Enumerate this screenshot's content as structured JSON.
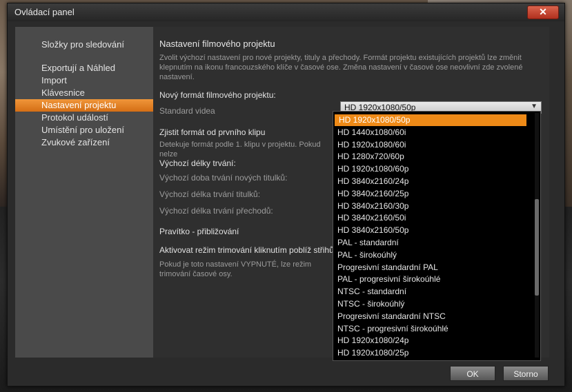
{
  "window": {
    "title": "Ovládací panel",
    "close_glyph": "✕"
  },
  "sidebar": {
    "items": [
      {
        "label": "Složky pro sledování"
      },
      {
        "label": "Exportují a Náhled"
      },
      {
        "label": "Import"
      },
      {
        "label": "Klávesnice"
      },
      {
        "label": "Nastavení projektu"
      },
      {
        "label": "Protokol událostí"
      },
      {
        "label": "Umístění pro uložení"
      },
      {
        "label": "Zvukové zařízení"
      }
    ],
    "active_index": 4
  },
  "content": {
    "heading": "Nastavení filmového projektu",
    "description": "Zvolit výchozí nastavení pro nové projekty, tituly a přechody. Formát projektu existujících projektů lze změnit klepnutím na ikonu francouzského klíče v časové ose. Změna nastavení v časové ose neovlivní zde zvolené nastavení.",
    "new_format_label": "Nový formát filmového projektu:",
    "standard_label": "Standard videa",
    "select_value": "HD 1920x1080/50p",
    "detect_label": "Zjistit formát od prvního klipu",
    "detect_desc": "Detekuje formát podle 1. klipu v projektu. Pokud nelze",
    "durations_label": "Výchozí délky trvání:",
    "dur_titles_new": "Výchozí doba trvání nových titulků:",
    "dur_titles": "Výchozí délka trvání titulků:",
    "dur_transitions": "Výchozí délka trvání přechodů:",
    "ruler_label": "Pravítko - přibližování",
    "trim_label": "Aktivovat režim trimování kliknutím poblíž střihů",
    "trim_desc": "Pokud je toto nastavení VYPNUTÉ, lze režim trimování časové osy."
  },
  "dropdown": {
    "options": [
      {
        "label": "HD 1920x1080/50p",
        "selected": true
      },
      {
        "label": "HD 1440x1080/60i"
      },
      {
        "label": "HD 1920x1080/60i"
      },
      {
        "label": "HD 1280x720/60p"
      },
      {
        "label": "HD 1920x1080/60p"
      },
      {
        "label": "HD 3840x2160/24p"
      },
      {
        "label": "HD 3840x2160/25p"
      },
      {
        "label": "HD 3840x2160/30p"
      },
      {
        "label": "HD 3840x2160/50i"
      },
      {
        "label": "HD 3840x2160/50p"
      },
      {
        "label": "PAL - standardní"
      },
      {
        "label": "PAL - širokoúhlý"
      },
      {
        "label": "Progresivní standardní PAL"
      },
      {
        "label": "PAL - progresivní širokoúhlé"
      },
      {
        "label": "NTSC - standardní"
      },
      {
        "label": "NTSC - širokoúhlý"
      },
      {
        "label": "Progresivní standardní NTSC"
      },
      {
        "label": "NTSC - progresivní širokoúhlé"
      },
      {
        "label": "HD 1920x1080/24p"
      },
      {
        "label": "HD 1920x1080/25p"
      }
    ]
  },
  "buttons": {
    "ok": "OK",
    "cancel": "Storno"
  },
  "colors": {
    "accent": "#ee8a17",
    "active_nav": "#e07e22"
  }
}
